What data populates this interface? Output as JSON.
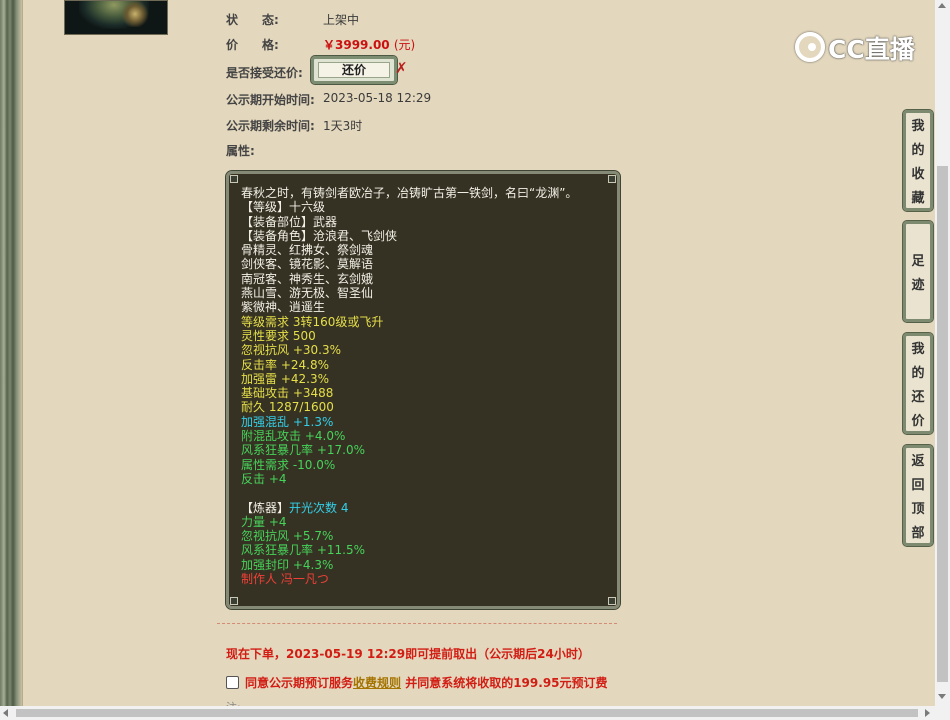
{
  "info": {
    "status_label": "状　　态:",
    "status_value": "上架中",
    "price_label": "价　　格:",
    "price_value": "￥3999.00",
    "price_unit": "(元)",
    "haggle_label": "是否接受还价:",
    "haggle_button": "还价",
    "haggle_mark": "✗",
    "start_label": "公示期开始时间:",
    "start_value": "2023-05-18 12:29",
    "remain_label": "公示期剩余时间:",
    "remain_value": "1天3时",
    "attr_label": "属性:"
  },
  "attributes": [
    {
      "text": "春秋之时，有铸剑者欧冶子，冶铸旷古第一铁剑，名曰“龙渊”。",
      "color": "white"
    },
    {
      "text": "【等级】十六级",
      "color": "white"
    },
    {
      "text": "【装备部位】武器",
      "color": "white"
    },
    {
      "text": "【装备角色】沧浪君、飞剑侠",
      "color": "white"
    },
    {
      "text": "骨精灵、红拂女、祭剑魂",
      "color": "white"
    },
    {
      "text": "剑侠客、镜花影、莫解语",
      "color": "white"
    },
    {
      "text": "南冠客、神秀生、玄剑娥",
      "color": "white"
    },
    {
      "text": "燕山雪、游无极、智圣仙",
      "color": "white"
    },
    {
      "text": "紫微神、逍遥生",
      "color": "white"
    },
    {
      "text": "等级需求 3转160级或飞升",
      "color": "yellow"
    },
    {
      "text": "灵性要求 500",
      "color": "yellow"
    },
    {
      "text": "忽视抗风 +30.3%",
      "color": "yellow"
    },
    {
      "text": "反击率 +24.8%",
      "color": "yellow"
    },
    {
      "text": "加强雷 +42.3%",
      "color": "yellow"
    },
    {
      "text": "基础攻击 +3488",
      "color": "yellow"
    },
    {
      "text": "耐久 1287/1600",
      "color": "yellow"
    },
    {
      "text": "加强混乱 +1.3%",
      "color": "cyan"
    },
    {
      "text": "附混乱攻击 +4.0%",
      "color": "green"
    },
    {
      "text": "风系狂暴几率 +17.0%",
      "color": "green"
    },
    {
      "text": "属性需求 -10.0%",
      "color": "green"
    },
    {
      "text": "反击 +4",
      "color": "green"
    },
    {
      "text": "",
      "color": "white"
    },
    {
      "text": "【炼器】",
      "color": "white",
      "extra": "开光次数 4",
      "extra_color": "cyan"
    },
    {
      "text": "力量 +4",
      "color": "green"
    },
    {
      "text": "忽视抗风 +5.7%",
      "color": "green"
    },
    {
      "text": "风系狂暴几率 +11.5%",
      "color": "green"
    },
    {
      "text": "加强封印 +4.3%",
      "color": "green"
    },
    {
      "text": "制作人 冯一凡つ",
      "color": "red"
    }
  ],
  "notice": "现在下单，2023-05-19 12:29即可提前取出（公示期后24小时）",
  "agree": {
    "prefix": "同意公示期预订服务",
    "link": "收费规则",
    "suffix": " 并同意系统将收取的199.95元预订费"
  },
  "cutoff_text": "注:",
  "logo": "CC直播",
  "sidebar": [
    {
      "name": "favorites",
      "chars": [
        "我",
        "的",
        "收",
        "藏"
      ]
    },
    {
      "name": "footprints",
      "chars": [
        "足",
        "迹"
      ]
    },
    {
      "name": "my-offers",
      "chars": [
        "我",
        "的",
        "还",
        "价"
      ]
    },
    {
      "name": "back-to-top",
      "chars": [
        "返",
        "回",
        "顶",
        "部"
      ]
    }
  ],
  "colors": {
    "page_bg": "#e3d7bd",
    "price_red": "#cc1010",
    "attr_bg": "#363223",
    "white": "#f2f0e6",
    "yellow": "#e5df4a",
    "cyan": "#33cfe8",
    "green": "#46d35a",
    "red": "#f04038"
  }
}
